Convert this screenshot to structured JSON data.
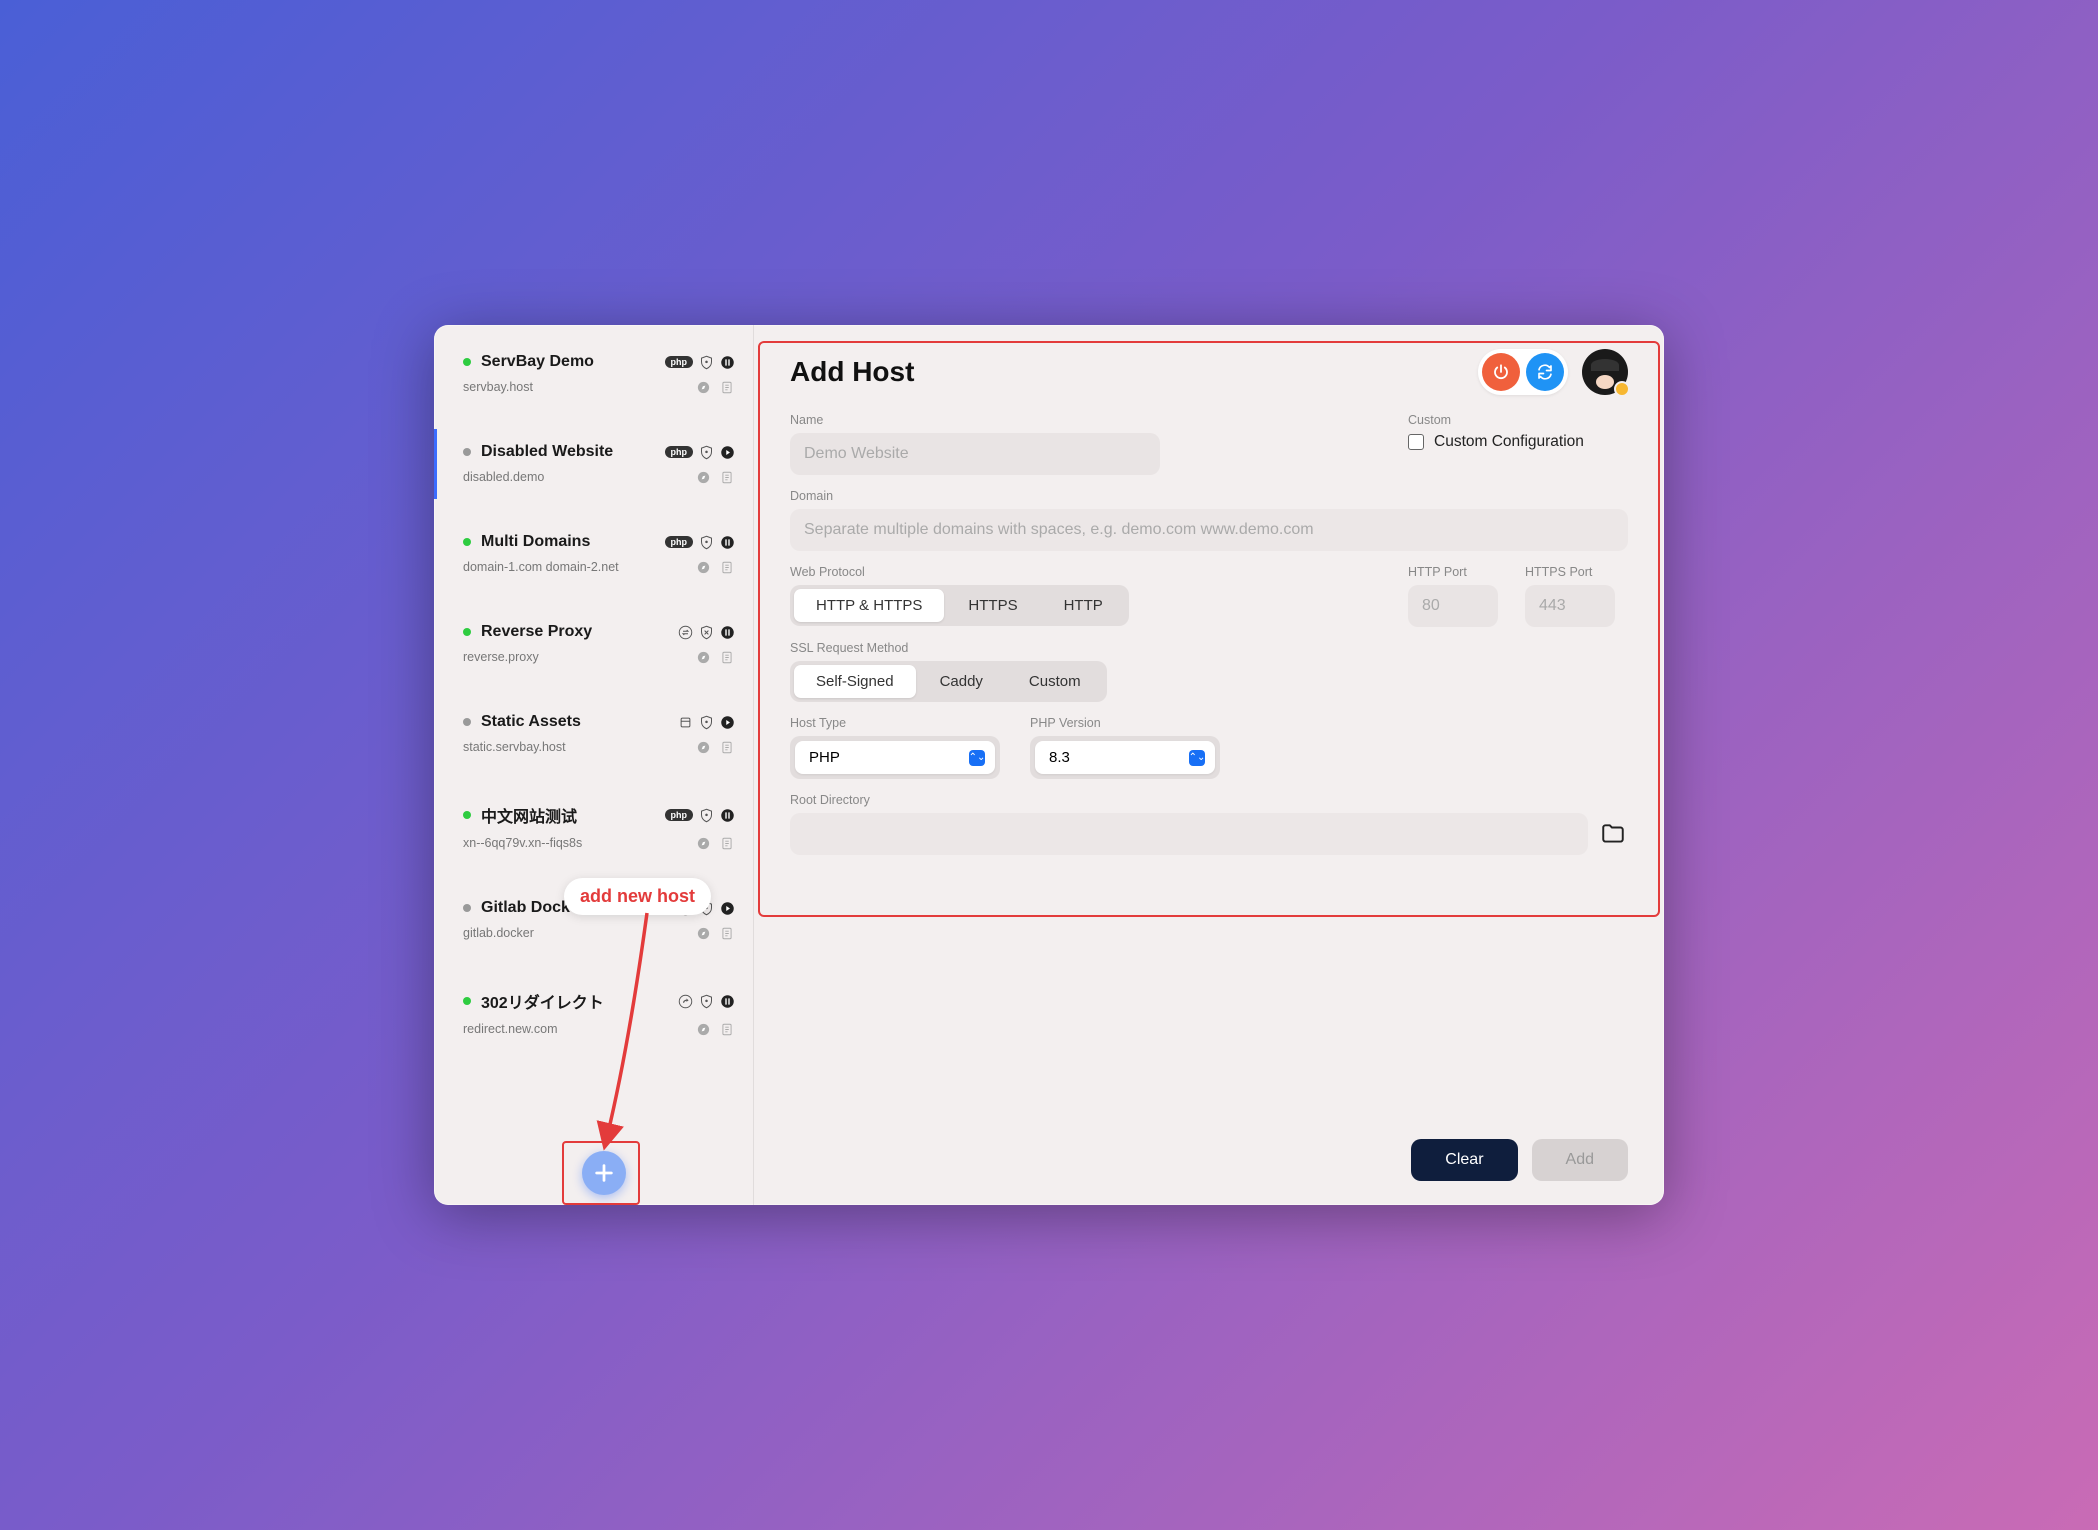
{
  "annotation": {
    "tip": "add new host"
  },
  "sidebar": {
    "items": [
      {
        "name": "ServBay Demo",
        "domain": "servbay.host",
        "status": "green",
        "tag": "php",
        "icons": [
          "php",
          "shield",
          "pause"
        ]
      },
      {
        "name": "Disabled Website",
        "domain": "disabled.demo",
        "status": "gray",
        "tag": "php",
        "icons": [
          "php",
          "shield",
          "play"
        ],
        "active": true
      },
      {
        "name": "Multi Domains",
        "domain": "domain-1.com domain-2.net",
        "status": "green",
        "tag": "php",
        "icons": [
          "php",
          "shield",
          "pause"
        ]
      },
      {
        "name": "Reverse Proxy",
        "domain": "reverse.proxy",
        "status": "green",
        "icons": [
          "swap",
          "shield-x",
          "pause"
        ]
      },
      {
        "name": "Static Assets",
        "domain": "static.servbay.host",
        "status": "gray",
        "icons": [
          "box",
          "shield",
          "play"
        ]
      },
      {
        "name": "中文网站测试",
        "domain": "xn--6qq79v.xn--fiqs8s",
        "status": "green",
        "tag": "php",
        "icons": [
          "php",
          "shield",
          "pause"
        ]
      },
      {
        "name": "Gitlab Docker",
        "domain": "gitlab.docker",
        "status": "gray",
        "icons": [
          "swap",
          "shield",
          "play"
        ]
      },
      {
        "name": "302リダイレクト",
        "domain": "redirect.new.com",
        "status": "green",
        "icons": [
          "redirect",
          "shield",
          "pause"
        ]
      }
    ]
  },
  "main": {
    "title": "Add Host",
    "name_label": "Name",
    "name_placeholder": "Demo Website",
    "custom_label": "Custom",
    "custom_check": "Custom Configuration",
    "domain_label": "Domain",
    "domain_placeholder": "Separate multiple domains with spaces, e.g. demo.com www.demo.com",
    "protocol_label": "Web Protocol",
    "protocol_options": [
      "HTTP & HTTPS",
      "HTTPS",
      "HTTP"
    ],
    "http_port_label": "HTTP Port",
    "http_port_placeholder": "80",
    "https_port_label": "HTTPS Port",
    "https_port_placeholder": "443",
    "ssl_label": "SSL Request Method",
    "ssl_options": [
      "Self-Signed",
      "Caddy",
      "Custom"
    ],
    "hosttype_label": "Host Type",
    "hosttype_value": "PHP",
    "phpver_label": "PHP Version",
    "phpver_value": "8.3",
    "root_label": "Root Directory"
  },
  "footer": {
    "clear": "Clear",
    "add": "Add"
  }
}
